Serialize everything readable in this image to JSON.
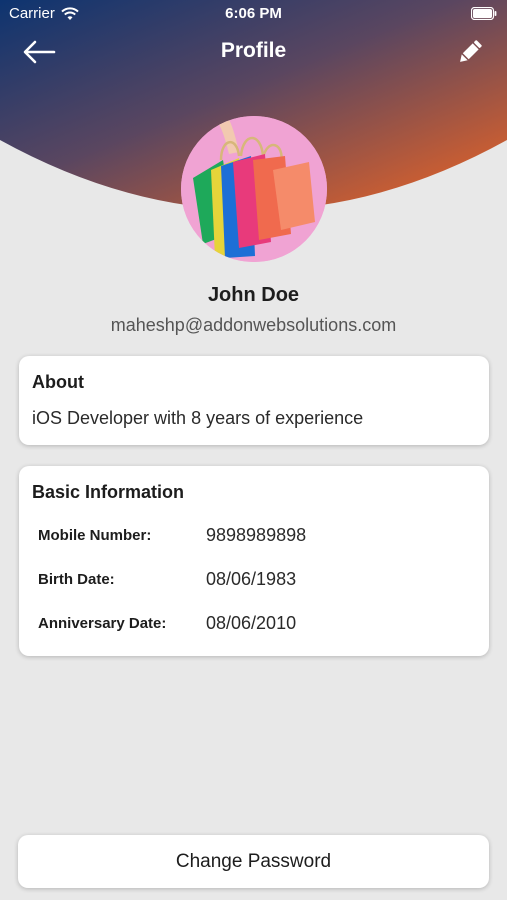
{
  "status_bar": {
    "carrier": "Carrier",
    "time": "6:06 PM"
  },
  "nav": {
    "title": "Profile",
    "back_icon": "arrow-left-icon",
    "edit_icon": "pencil-icon"
  },
  "colors": {
    "header_gradient_start": "#0d3470",
    "header_gradient_end": "#ee6623",
    "background": "#e8e8e8",
    "card": "#ffffff",
    "avatar_background": "#f0a3d3"
  },
  "profile": {
    "avatar_image": "shopping-bags-photo",
    "name": "John Doe",
    "email": "maheshp@addonwebsolutions.com"
  },
  "about": {
    "title": "About",
    "text": "iOS Developer with 8 years of experience"
  },
  "basic_information": {
    "title": "Basic Information",
    "rows": [
      {
        "label": "Mobile Number:",
        "value": "9898989898"
      },
      {
        "label": "Birth Date:",
        "value": "08/06/1983"
      },
      {
        "label": "Anniversary Date:",
        "value": "08/06/2010"
      }
    ]
  },
  "actions": {
    "change_password": "Change Password"
  }
}
